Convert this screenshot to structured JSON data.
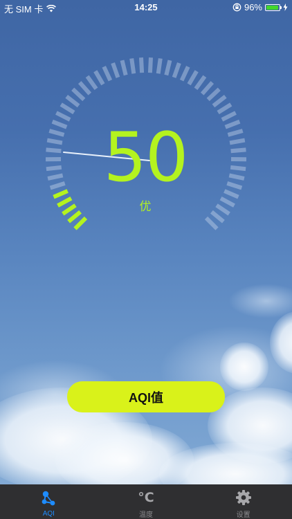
{
  "status_bar": {
    "carrier": "无 SIM 卡",
    "wifi_icon": "wifi-icon",
    "time": "14:25",
    "orientation_lock_icon": "orientation-lock-icon",
    "battery_percent": "96%",
    "battery_level": 0.96,
    "charging_icon": "charging-bolt-icon"
  },
  "gauge": {
    "aqi_value": "50",
    "level_label": "优",
    "fill_fraction": 0.09,
    "active_color": "#b4f31f",
    "track_color": "rgba(200,215,235,0.42)"
  },
  "action_button": {
    "label": "AQI值",
    "color": "#d9f21a"
  },
  "tab_bar": {
    "tabs": [
      {
        "label": "AQI",
        "icon": "network-nodes-icon",
        "active": true
      },
      {
        "label": "温度",
        "icon": "celsius-icon",
        "icon_text": "°C",
        "active": false
      },
      {
        "label": "设置",
        "icon": "gear-icon",
        "active": false
      }
    ],
    "active_color": "#1e8cff",
    "inactive_color": "#8b8b8f"
  }
}
